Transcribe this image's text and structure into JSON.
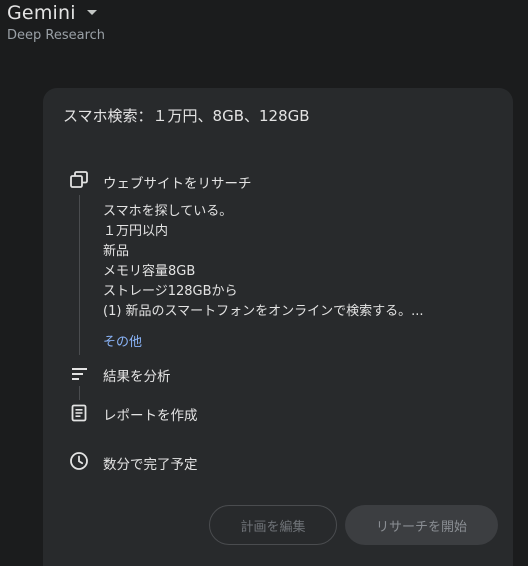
{
  "header": {
    "app_title": "Gemini",
    "subtitle": "Deep Research"
  },
  "card": {
    "title": "スマホ検索：１万円、8GB、128GB",
    "steps": {
      "research": {
        "label": "ウェブサイトをリサーチ",
        "icon": "web-research-icon",
        "details": [
          "スマホを探している。",
          "１万円以内",
          "新品",
          "メモリ容量8GB",
          "ストレージ128GBから",
          "(1) 新品のスマートフォンをオンラインで検索する。..."
        ],
        "more_label": "その他"
      },
      "analyze": {
        "label": "結果を分析",
        "icon": "sort-lines-icon"
      },
      "report": {
        "label": "レポートを作成",
        "icon": "document-icon"
      },
      "eta": {
        "label": "数分で完了予定",
        "icon": "clock-icon"
      }
    },
    "buttons": {
      "edit_plan": "計画を編集",
      "start_research": "リサーチを開始"
    }
  },
  "colors": {
    "background": "#1b1c1d",
    "card": "#282a2c",
    "text": "#e3e3e3",
    "muted": "#9aa0a6",
    "link": "#8ab4f8"
  }
}
